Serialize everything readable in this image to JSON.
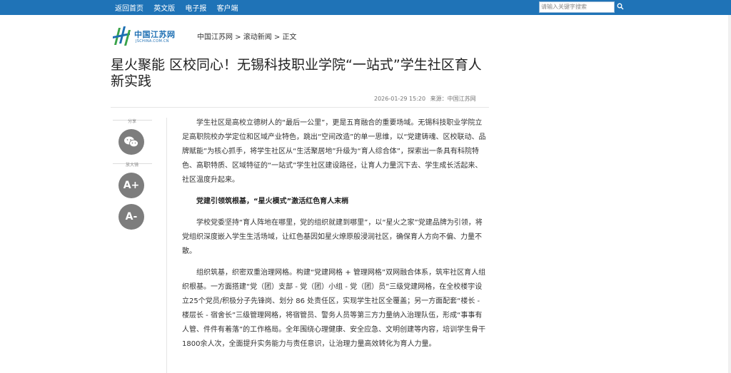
{
  "topbar": {
    "links": [
      "返回首页",
      "英文版",
      "电子报",
      "客户端"
    ],
    "search_placeholder": "请输入关键字搜索"
  },
  "logo": {
    "name": "中国江苏网",
    "domain": "JSCHINA.COM.CN"
  },
  "breadcrumb": "中国江苏网 > 滚动新闻 > 正文",
  "article": {
    "title": "星火聚能 区校同心！无锡科技职业学院“一站式”学生社区育人新实践",
    "datetime": "2026-01-29 15:20",
    "source": "来源：中国江苏网",
    "paragraphs": [
      "学生社区是高校立德树人的“最后一公里”，更是五育融合的重要场域。无锡科技职业学院立足高职院校办学定位和区域产业特色，跳出“空间改造”的单一思维，以“党建铸魂、区校联动、品牌赋能”为核心抓手，将学生社区从“生活聚居地”升级为“育人综合体”，探索出一条具有科院特色、高职特质、区域特征的“一站式”学生社区建设路径，让育人力量沉下去、学生成长活起来、社区温度升起来。",
      "党建引领筑根基，“星火模式”激活红色育人末梢",
      "学校党委坚持“育人阵地在哪里，党的组织就建到哪里”，以“星火之家”党建品牌为引领，将党组织深度嵌入学生生活场域，让红色基因如星火燎原般浸润社区，确保育人方向不偏、力量不散。",
      "组织筑基，织密双重治理网格。构建“党建网格 + 管理网格”双网融合体系，筑牢社区育人组织根基。一方面搭建“党（团）支部 - 党（团）小组 - 党（团）员”三级党建网格，在全校楼宇设立25个党员/积极分子先锋岗、划分 86 处责任区，实现学生社区全覆盖；另一方面配套“楼长 - 楼层长 - 宿舍长”三级管理网格，将宿管员、警务人员等第三方力量纳入治理队伍，形成“事事有人管、件件有着落”的工作格局。全年围绕心理健康、安全应急、文明创建等内容，培训学生骨干1800余人次，全面提升实务能力与责任意识，让治理力量高效转化为育人力量。"
    ]
  },
  "sidebar": {
    "share_label": "分享",
    "zoom_label": "放大镜",
    "zoom_in": "A+",
    "zoom_out": "A-"
  },
  "colors": {
    "topbar": "#1f73b7",
    "accent": "#1d6fb3",
    "logo_green": "#3aa34a",
    "button_gray": "#7d7d7d"
  }
}
